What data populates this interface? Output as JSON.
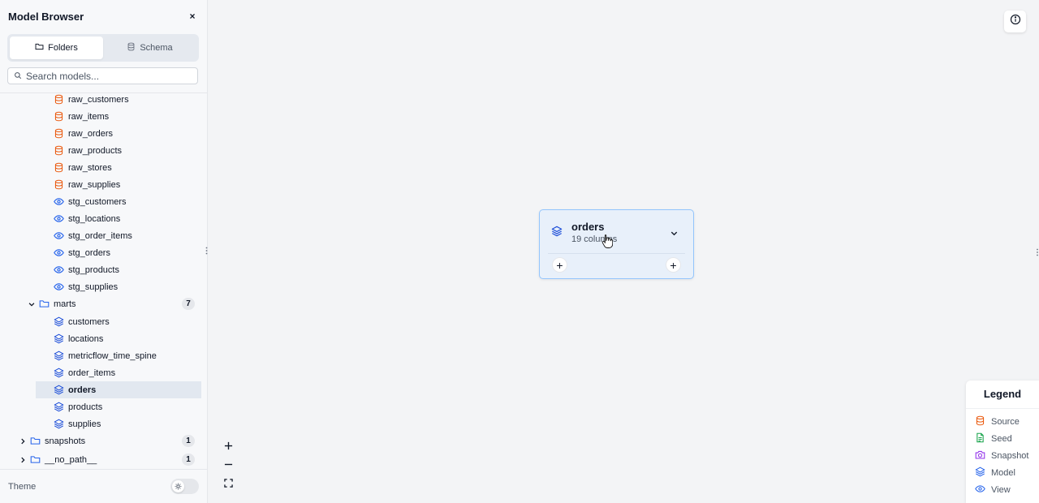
{
  "sidebar": {
    "title": "Model Browser",
    "close_label": "×",
    "tabs": [
      {
        "label": "Folders",
        "active": true
      },
      {
        "label": "Schema",
        "active": false
      }
    ],
    "search_placeholder": "Search models...",
    "tree": [
      {
        "kind": "source",
        "label": "raw_customers"
      },
      {
        "kind": "source",
        "label": "raw_items"
      },
      {
        "kind": "source",
        "label": "raw_orders"
      },
      {
        "kind": "source",
        "label": "raw_products"
      },
      {
        "kind": "source",
        "label": "raw_stores"
      },
      {
        "kind": "source",
        "label": "raw_supplies"
      },
      {
        "kind": "view",
        "label": "stg_customers"
      },
      {
        "kind": "view",
        "label": "stg_locations"
      },
      {
        "kind": "view",
        "label": "stg_order_items"
      },
      {
        "kind": "view",
        "label": "stg_orders"
      },
      {
        "kind": "view",
        "label": "stg_products"
      },
      {
        "kind": "view",
        "label": "stg_supplies"
      },
      {
        "kind": "folder",
        "label": "marts",
        "count": "7",
        "expanded": true
      },
      {
        "kind": "model",
        "label": "customers"
      },
      {
        "kind": "model",
        "label": "locations"
      },
      {
        "kind": "model",
        "label": "metricflow_time_spine"
      },
      {
        "kind": "model",
        "label": "order_items"
      },
      {
        "kind": "model",
        "label": "orders",
        "selected": true
      },
      {
        "kind": "model",
        "label": "products"
      },
      {
        "kind": "model",
        "label": "supplies"
      },
      {
        "kind": "folder",
        "label": "snapshots",
        "count": "1",
        "expanded": false
      },
      {
        "kind": "folder",
        "label": "__no_path__",
        "count": "1",
        "expanded": false
      }
    ],
    "theme_label": "Theme"
  },
  "canvas": {
    "node": {
      "title": "orders",
      "subtitle": "19 columns",
      "icon": "model-icon"
    },
    "zoom_controls": [
      "zoom-in",
      "zoom-out",
      "fit-view"
    ],
    "legend": {
      "title": "Legend",
      "items": [
        {
          "label": "Source",
          "icon": "source-icon",
          "color": "#ea580c"
        },
        {
          "label": "Seed",
          "icon": "seed-icon",
          "color": "#16a34a"
        },
        {
          "label": "Snapshot",
          "icon": "snapshot-icon",
          "color": "#9333ea"
        },
        {
          "label": "Model",
          "icon": "model-icon",
          "color": "#2563eb"
        },
        {
          "label": "View",
          "icon": "view-icon",
          "color": "#2563eb"
        }
      ]
    }
  },
  "colors": {
    "source": "#ea580c",
    "model": "#1d4ed8",
    "view": "#2563eb",
    "node_border": "#93c5fd",
    "node_bg": "#e8f0fa"
  }
}
